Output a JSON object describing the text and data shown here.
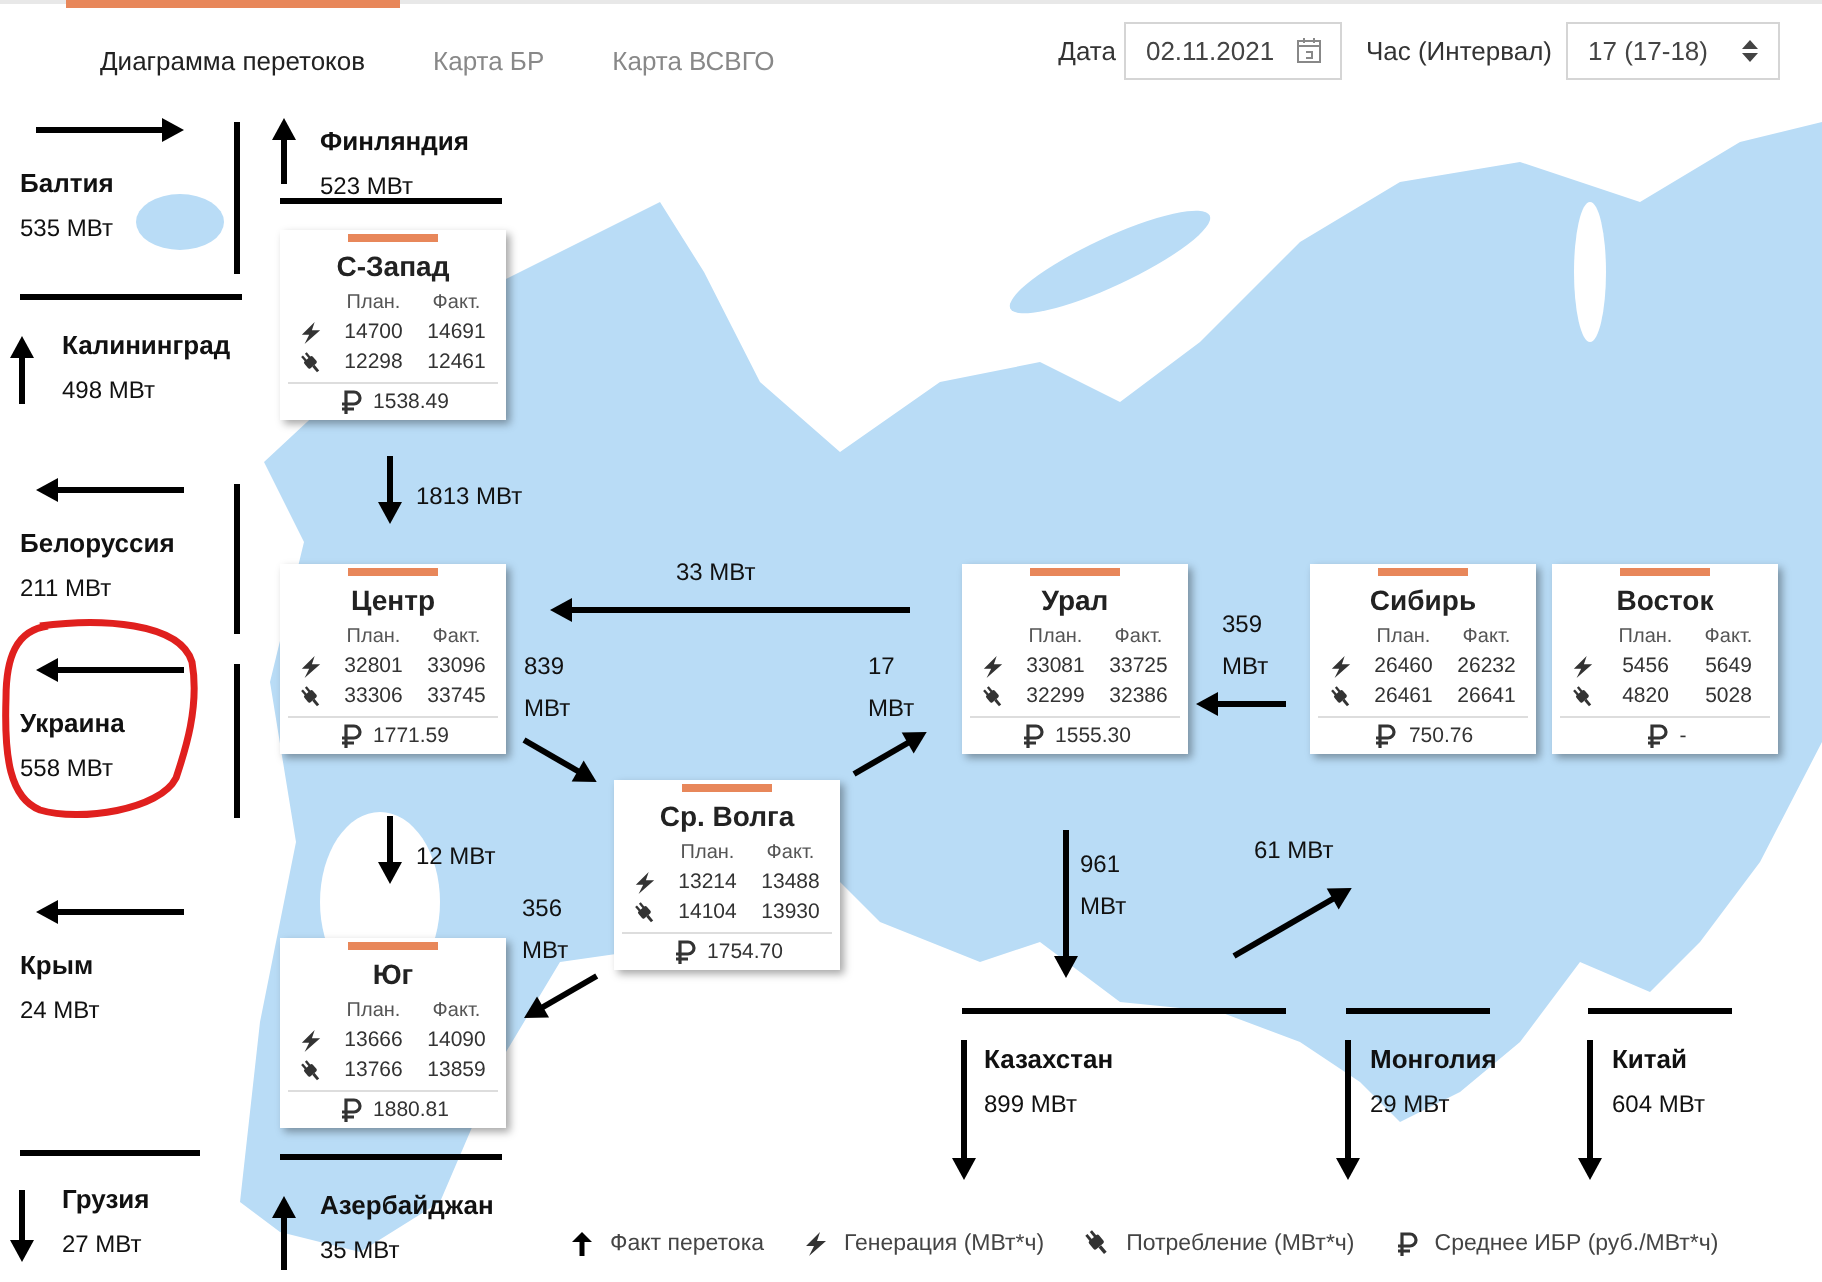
{
  "tabs": [
    {
      "label": "Диаграмма перетоков",
      "selected": true
    },
    {
      "label": "Карта БР",
      "selected": false
    },
    {
      "label": "Карта ВСВГО",
      "selected": false
    }
  ],
  "date": {
    "label": "Дата",
    "value": "02.11.2021"
  },
  "hour": {
    "label": "Час (Интервал)",
    "value": "17 (17-18)"
  },
  "regions": [
    {
      "name": "С-Запад",
      "columns": [
        "План.",
        "Факт."
      ],
      "generation": [
        "14700",
        "14691"
      ],
      "consumption": [
        "12298",
        "12461"
      ],
      "price": "1538.49"
    },
    {
      "name": "Центр",
      "columns": [
        "План.",
        "Факт."
      ],
      "generation": [
        "32801",
        "33096"
      ],
      "consumption": [
        "33306",
        "33745"
      ],
      "price": "1771.59"
    },
    {
      "name": "Ср. Волга",
      "columns": [
        "План.",
        "Факт."
      ],
      "generation": [
        "13214",
        "13488"
      ],
      "consumption": [
        "14104",
        "13930"
      ],
      "price": "1754.70"
    },
    {
      "name": "Юг",
      "columns": [
        "План.",
        "Факт."
      ],
      "generation": [
        "13666",
        "14090"
      ],
      "consumption": [
        "13766",
        "13859"
      ],
      "price": "1880.81"
    },
    {
      "name": "Урал",
      "columns": [
        "План.",
        "Факт."
      ],
      "generation": [
        "33081",
        "33725"
      ],
      "consumption": [
        "32299",
        "32386"
      ],
      "price": "1555.30"
    },
    {
      "name": "Сибирь",
      "columns": [
        "План.",
        "Факт."
      ],
      "generation": [
        "26460",
        "26232"
      ],
      "consumption": [
        "26461",
        "26641"
      ],
      "price": "750.76"
    },
    {
      "name": "Восток",
      "columns": [
        "План.",
        "Факт."
      ],
      "generation": [
        "5456",
        "5649"
      ],
      "consumption": [
        "4820",
        "5028"
      ],
      "price": "-"
    }
  ],
  "flows": [
    {
      "value": "1813 МВт",
      "kind": "down"
    },
    {
      "value": "33 МВт",
      "kind": "left"
    },
    {
      "value": "839 МВт",
      "kind": "down-right"
    },
    {
      "value": "17 МВт",
      "kind": "up-right"
    },
    {
      "value": "12 МВт",
      "kind": "down"
    },
    {
      "value": "356 МВт",
      "kind": "down-left"
    },
    {
      "value": "359 МВт",
      "kind": "left"
    },
    {
      "value": "961 МВт",
      "kind": "down"
    },
    {
      "value": "61 МВт",
      "kind": "up-right"
    }
  ],
  "borders": [
    {
      "name": "Балтия",
      "value": "535 МВт",
      "kind": "right",
      "circled": false
    },
    {
      "name": "Финляндия",
      "value": "523 МВт",
      "kind": "up",
      "circled": false
    },
    {
      "name": "Калининград",
      "value": "498 МВт",
      "kind": "up",
      "circled": false
    },
    {
      "name": "Белоруссия",
      "value": "211 МВт",
      "kind": "left",
      "circled": false
    },
    {
      "name": "Украина",
      "value": "558 МВт",
      "kind": "left",
      "circled": true
    },
    {
      "name": "Крым",
      "value": "24 МВт",
      "kind": "left",
      "circled": false
    },
    {
      "name": "Грузия",
      "value": "27 МВт",
      "kind": "down",
      "circled": false
    },
    {
      "name": "Азербайджан",
      "value": "35 МВт",
      "kind": "up",
      "circled": false
    },
    {
      "name": "Казахстан",
      "value": "899 МВт",
      "kind": "down",
      "circled": false
    },
    {
      "name": "Монголия",
      "value": "29 МВт",
      "kind": "down",
      "circled": false
    },
    {
      "name": "Китай",
      "value": "604 МВт",
      "kind": "down",
      "circled": false
    }
  ],
  "legend": [
    {
      "kind": "flow",
      "label": "Факт перетока"
    },
    {
      "kind": "generation",
      "label": "Генерация (МВт*ч)"
    },
    {
      "kind": "consumption",
      "label": "Потребление (МВт*ч)"
    },
    {
      "kind": "price",
      "label": "Среднее ИБР (руб./МВт*ч)"
    }
  ]
}
